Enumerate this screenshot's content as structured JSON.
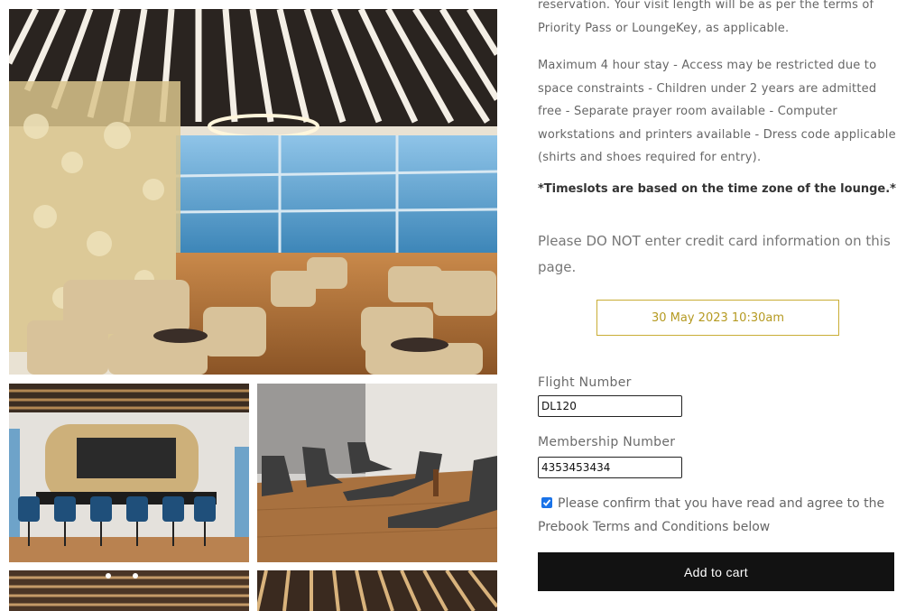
{
  "description": {
    "intro": "reservation. Your visit length will be as per the terms of Priority Pass or LoungeKey, as applicable.",
    "rules": "Maximum 4 hour stay - Access may be restricted due to space constraints - Children under 2 years are admitted free - Separate prayer room available - Computer workstations and printers available - Dress code applicable (shirts and shoes required for entry).",
    "timeslot_note": "*Timeslots are based on the time zone of the lounge.*",
    "cc_warning": "Please DO NOT enter credit card information on this page."
  },
  "booking": {
    "selected_slot": "30 May 2023 10:30am",
    "flight_label": "Flight Number",
    "flight_value": "DL120",
    "membership_label": "Membership Number",
    "membership_value": "4353453434",
    "confirm_text": "Please confirm that you have read and agree to the Prebook Terms and Conditions below",
    "confirm_checked": true,
    "add_to_cart_label": "Add to cart"
  },
  "colors": {
    "accent_gold": "#c9ad36",
    "button_bg": "#121212",
    "checkbox_blue": "#1a73e8"
  },
  "gallery": {
    "images": [
      "lounge-seating-photo",
      "lounge-bar-photo",
      "lounge-recliners-photo",
      "lounge-ceiling-photo",
      "lounge-ceiling-photo-2"
    ]
  }
}
